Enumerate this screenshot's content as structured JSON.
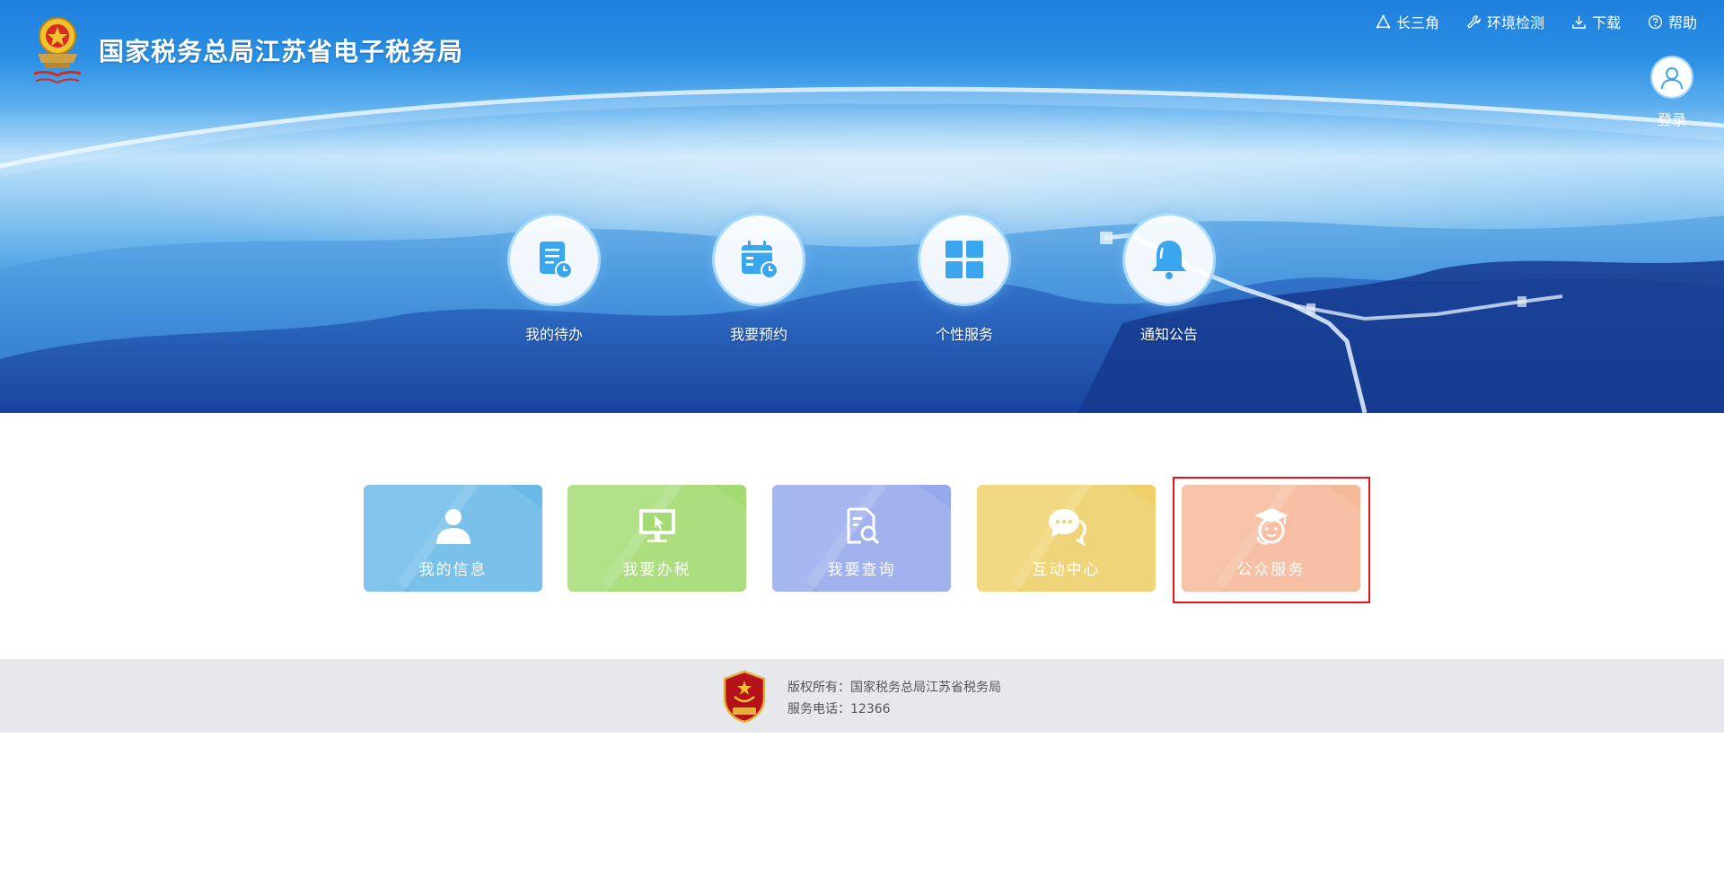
{
  "header": {
    "title": "国家税务总局江苏省电子税务局",
    "logo_icon": "tax-emblem-icon",
    "links": [
      {
        "label": "长三角",
        "icon": "triangle-network-icon"
      },
      {
        "label": "环境检测",
        "icon": "wrench-icon"
      },
      {
        "label": "下载",
        "icon": "download-icon"
      },
      {
        "label": "帮助",
        "icon": "help-circle-icon"
      }
    ],
    "login_label": "登录"
  },
  "quick_access": [
    {
      "label": "我的待办",
      "icon": "todo-document-clock-icon"
    },
    {
      "label": "我要预约",
      "icon": "calendar-clock-icon"
    },
    {
      "label": "个性服务",
      "icon": "grid-four-icon"
    },
    {
      "label": "通知公告",
      "icon": "bell-icon"
    }
  ],
  "cards": [
    {
      "label": "我的信息",
      "icon": "user-icon",
      "color": "#6ab9e8"
    },
    {
      "label": "我要办税",
      "icon": "monitor-cursor-icon",
      "color": "#a3db72"
    },
    {
      "label": "我要查询",
      "icon": "document-search-icon",
      "color": "#96a9ec"
    },
    {
      "label": "互动中心",
      "icon": "chat-bubbles-icon",
      "color": "#efd06a"
    },
    {
      "label": "公众服务",
      "icon": "graduate-face-icon",
      "color": "#f5b899"
    }
  ],
  "highlighted_card": "公众服务",
  "footer": {
    "badge_icon": "party-government-badge-icon",
    "copyright": "版权所有：国家税务总局江苏省税务局",
    "service_phone": "服务电话：12366"
  },
  "colors": {
    "accent": "#3aa6ee",
    "highlight_border": "#e8141b",
    "footer_bg": "#e7e8eb"
  }
}
